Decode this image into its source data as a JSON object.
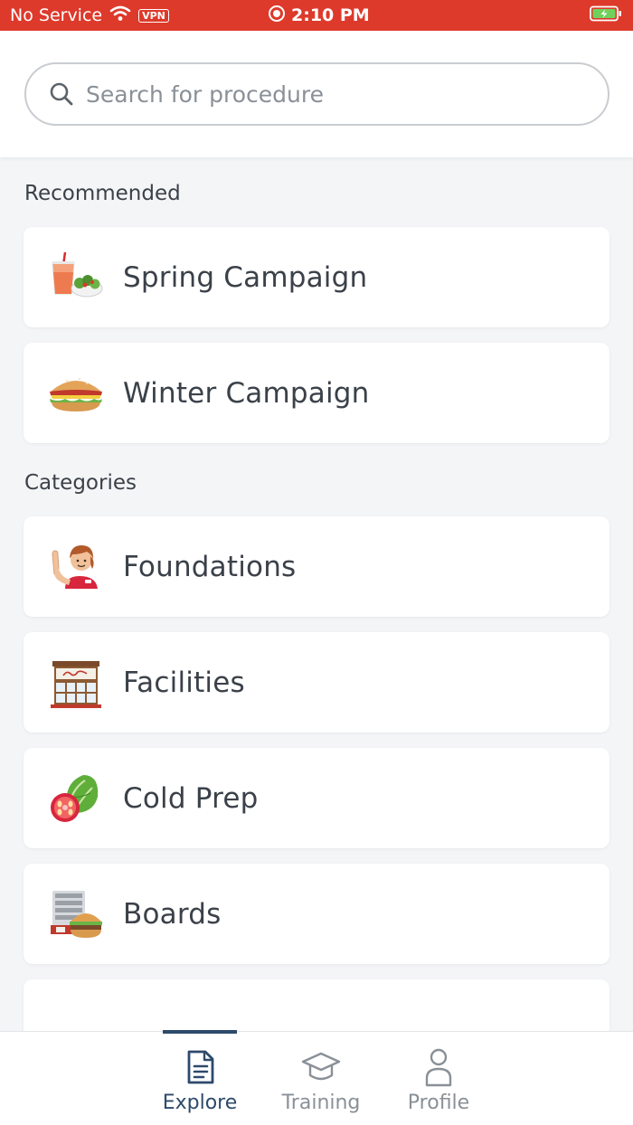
{
  "status_bar": {
    "carrier": "No Service",
    "vpn": "VPN",
    "time": "2:10 PM"
  },
  "search": {
    "placeholder": "Search for procedure"
  },
  "sections": {
    "recommended_label": "Recommended",
    "categories_label": "Categories"
  },
  "recommended": [
    {
      "label": "Spring Campaign",
      "icon": "drink-and-salad-icon"
    },
    {
      "label": "Winter Campaign",
      "icon": "sandwich-icon"
    }
  ],
  "categories": [
    {
      "label": "Foundations",
      "icon": "waving-employee-icon"
    },
    {
      "label": "Facilities",
      "icon": "restaurant-building-icon"
    },
    {
      "label": "Cold Prep",
      "icon": "lettuce-tomato-icon"
    },
    {
      "label": "Boards",
      "icon": "burger-tray-icon"
    }
  ],
  "bottom_nav": {
    "explore": "Explore",
    "training": "Training",
    "profile": "Profile",
    "active": "explore"
  },
  "colors": {
    "status_bar": "#dd3a2b",
    "accent": "#2e4a6b",
    "text": "#3b4149",
    "muted": "#8a9097",
    "background": "#f4f5f7"
  }
}
